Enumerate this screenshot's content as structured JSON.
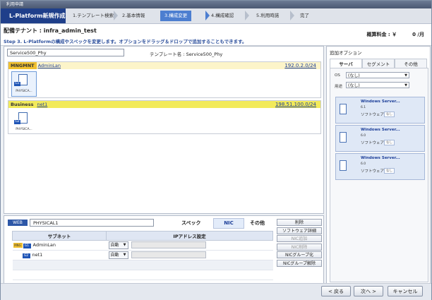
{
  "window": {
    "title": "利用申請"
  },
  "wizard": {
    "app_title": "L-Platform新規作成",
    "steps": [
      "1.テンプレート検索",
      "2.基本情報",
      "3.構成変更",
      "4.構成確認",
      "5.利用時諾",
      "完了"
    ]
  },
  "header": {
    "tenant": "配備テナント : infra_admin_test",
    "price_label": "概算料金 : ￥",
    "price_value": "0 /月",
    "hint": "Step 3. L-Platformの構成やスペックを変更します。オプションをドラッグ＆ドロップで追加することもできます。"
  },
  "main": {
    "name_value": "Service500_Phy",
    "template_name": "テンプレート名 : Service500_Phy",
    "segments": [
      {
        "tag": "MNGMNT",
        "name": "AdminLan",
        "address": "192.0.2.0/24",
        "server": {
          "badge": "G1",
          "label": "PHYSICA..."
        }
      },
      {
        "tag": "Business",
        "name": "net1",
        "address": "198.51.100.0/24",
        "server": {
          "badge": "G2",
          "label": "PHYSICA..."
        }
      }
    ]
  },
  "bottom": {
    "web_tag": "WEB",
    "server_name": "PHYSICAL1",
    "tabs": {
      "spec": "スペック",
      "nic": "NIC",
      "other": "その他"
    },
    "table": {
      "headers": [
        "サブネット",
        "IPアドレス設定"
      ],
      "rows": [
        {
          "mng": "MNG",
          "badge": "G1",
          "subnet": "AdminLan",
          "mode": "自動"
        },
        {
          "mng": "",
          "badge": "G2",
          "subnet": "net1",
          "mode": "自動"
        }
      ]
    },
    "buttons": {
      "delete": "削除",
      "software_detail": "ソフトウェア詳細",
      "nic_add": "NIC追加",
      "nic_delete": "NIC削除",
      "nic_group": "NICグループ化",
      "nic_ungroup": "NICグループ解除"
    }
  },
  "right": {
    "title": "追加オプション",
    "tabs": [
      "サーバ",
      "セグメント",
      "その他"
    ],
    "os_label": "OS",
    "os_value": "(なし)",
    "usage_label": "用途",
    "usage_value": "(なし)",
    "cards": [
      {
        "name": "Windows Server...",
        "version": "6.1",
        "type": "ソフトウェア",
        "badge": "なし"
      },
      {
        "name": "Windows Server...",
        "version": "6.0",
        "type": "ソフトウェア",
        "badge": "なし"
      },
      {
        "name": "Windows Server...",
        "version": "6.0",
        "type": "ソフトウェア",
        "badge": "なし"
      }
    ]
  },
  "footer": {
    "back": "< 戻る",
    "next": "次へ >",
    "cancel": "キャンセル"
  }
}
